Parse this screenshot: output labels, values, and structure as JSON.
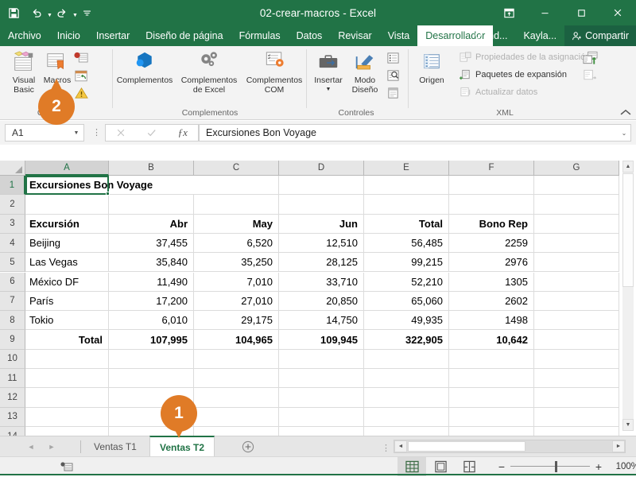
{
  "titlebar": {
    "document_title": "02-crear-macros  -  Excel",
    "quick_access": [
      {
        "name": "save-icon",
        "label": "Guardar"
      },
      {
        "name": "undo-icon",
        "label": "Deshacer"
      },
      {
        "name": "redo-icon",
        "label": "Rehacer"
      },
      {
        "name": "customize-qat-icon",
        "label": "Personalizar barra de herramientas de acceso rápido"
      }
    ],
    "window_buttons": [
      {
        "name": "ribbon-display-options-icon",
        "label": "Opciones de presentación de la cinta"
      },
      {
        "name": "minimize-icon",
        "label": "Minimizar",
        "glyph": "─"
      },
      {
        "name": "restore-icon",
        "label": "Restaurar",
        "glyph": "☐"
      },
      {
        "name": "close-icon",
        "label": "Cerrar",
        "glyph": "✕"
      }
    ]
  },
  "ribbon_tabs": {
    "items": [
      {
        "label": "Archivo",
        "active": false
      },
      {
        "label": "Inicio",
        "active": false
      },
      {
        "label": "Insertar",
        "active": false
      },
      {
        "label": "Diseño de página",
        "active": false
      },
      {
        "label": "Fórmulas",
        "active": false
      },
      {
        "label": "Datos",
        "active": false
      },
      {
        "label": "Revisar",
        "active": false
      },
      {
        "label": "Vista",
        "active": false
      },
      {
        "label": "Desarrollador",
        "active": true
      }
    ],
    "tell_me": "Ind...",
    "account_name": "Kayla...",
    "share_label": "Compartir"
  },
  "ribbon": {
    "groups": [
      {
        "name": "codigo",
        "label": "Có...",
        "buttons": [
          {
            "label_line1": "Visual",
            "label_line2": "Basic",
            "icon": "visual-basic-icon"
          },
          {
            "label_line1": "Macros",
            "label_line2": "",
            "icon": "macros-icon"
          }
        ],
        "small_icons": [
          {
            "name": "record-macro-icon"
          },
          {
            "name": "relative-references-icon"
          },
          {
            "name": "macro-security-icon"
          }
        ]
      },
      {
        "name": "complementos",
        "label": "Complementos",
        "buttons": [
          {
            "label_line1": "Complementos",
            "label_line2": "",
            "icon": "addins-store-icon"
          },
          {
            "label_line1": "Complementos",
            "label_line2": "de Excel",
            "icon": "excel-addins-icon"
          },
          {
            "label_line1": "Complementos",
            "label_line2": "COM",
            "icon": "com-addins-icon"
          }
        ]
      },
      {
        "name": "controles",
        "label": "Controles",
        "buttons": [
          {
            "label_line1": "Insertar",
            "label_line2": "",
            "icon": "insert-control-icon",
            "has_dropdown": true
          },
          {
            "label_line1": "Modo",
            "label_line2": "Diseño",
            "icon": "design-mode-icon"
          }
        ],
        "small_icons": [
          {
            "name": "properties-icon"
          },
          {
            "name": "view-code-icon"
          },
          {
            "name": "run-dialog-icon"
          }
        ]
      },
      {
        "name": "xml",
        "label": "XML",
        "buttons": [
          {
            "label_line1": "Origen",
            "label_line2": "",
            "icon": "xml-source-icon"
          }
        ],
        "commands": [
          {
            "label": "Propiedades de la asignación",
            "icon": "map-properties-icon",
            "disabled": true
          },
          {
            "label": "Paquetes de expansión",
            "icon": "expansion-packs-icon",
            "disabled": false
          },
          {
            "label": "Actualizar datos",
            "icon": "refresh-data-icon",
            "disabled": true
          }
        ],
        "small_icons": [
          {
            "name": "import-xml-icon"
          },
          {
            "name": "export-xml-icon"
          }
        ]
      }
    ],
    "collapse_label": "Contraer la cinta de opciones"
  },
  "formula_bar": {
    "name_box_value": "A1",
    "cancel_label": "Cancelar",
    "enter_label": "Introducir",
    "function_label": "Insertar función",
    "formula_value": "Excursiones Bon Voyage"
  },
  "grid": {
    "columns": [
      "A",
      "B",
      "C",
      "D",
      "E",
      "F",
      "G"
    ],
    "selected_column": "A",
    "rows": [
      1,
      2,
      3,
      4,
      5,
      6,
      7,
      8,
      9,
      10,
      11,
      12,
      13,
      14
    ],
    "selected_row": 1,
    "selected_cell": "A1",
    "cells": [
      {
        "row": 1,
        "col": "A",
        "value": "Excursiones Bon Voyage",
        "bold": true,
        "align": "left",
        "overflow": true
      },
      {
        "row": 3,
        "col": "A",
        "value": "Excursión",
        "bold": true,
        "align": "left"
      },
      {
        "row": 3,
        "col": "B",
        "value": "Abr",
        "bold": true,
        "align": "right"
      },
      {
        "row": 3,
        "col": "C",
        "value": "May",
        "bold": true,
        "align": "right"
      },
      {
        "row": 3,
        "col": "D",
        "value": "Jun",
        "bold": true,
        "align": "right"
      },
      {
        "row": 3,
        "col": "E",
        "value": "Total",
        "bold": true,
        "align": "right"
      },
      {
        "row": 3,
        "col": "F",
        "value": "Bono Rep",
        "bold": true,
        "align": "right"
      },
      {
        "row": 4,
        "col": "A",
        "value": "Beijing",
        "bold": false,
        "align": "left"
      },
      {
        "row": 4,
        "col": "B",
        "value": "37,455",
        "bold": false,
        "align": "right"
      },
      {
        "row": 4,
        "col": "C",
        "value": "6,520",
        "bold": false,
        "align": "right"
      },
      {
        "row": 4,
        "col": "D",
        "value": "12,510",
        "bold": false,
        "align": "right"
      },
      {
        "row": 4,
        "col": "E",
        "value": "56,485",
        "bold": false,
        "align": "right"
      },
      {
        "row": 4,
        "col": "F",
        "value": "2259",
        "bold": false,
        "align": "right"
      },
      {
        "row": 5,
        "col": "A",
        "value": "Las Vegas",
        "bold": false,
        "align": "left"
      },
      {
        "row": 5,
        "col": "B",
        "value": "35,840",
        "bold": false,
        "align": "right"
      },
      {
        "row": 5,
        "col": "C",
        "value": "35,250",
        "bold": false,
        "align": "right"
      },
      {
        "row": 5,
        "col": "D",
        "value": "28,125",
        "bold": false,
        "align": "right"
      },
      {
        "row": 5,
        "col": "E",
        "value": "99,215",
        "bold": false,
        "align": "right"
      },
      {
        "row": 5,
        "col": "F",
        "value": "2976",
        "bold": false,
        "align": "right"
      },
      {
        "row": 6,
        "col": "A",
        "value": "México DF",
        "bold": false,
        "align": "left"
      },
      {
        "row": 6,
        "col": "B",
        "value": "11,490",
        "bold": false,
        "align": "right"
      },
      {
        "row": 6,
        "col": "C",
        "value": "7,010",
        "bold": false,
        "align": "right"
      },
      {
        "row": 6,
        "col": "D",
        "value": "33,710",
        "bold": false,
        "align": "right"
      },
      {
        "row": 6,
        "col": "E",
        "value": "52,210",
        "bold": false,
        "align": "right"
      },
      {
        "row": 6,
        "col": "F",
        "value": "1305",
        "bold": false,
        "align": "right"
      },
      {
        "row": 7,
        "col": "A",
        "value": "París",
        "bold": false,
        "align": "left"
      },
      {
        "row": 7,
        "col": "B",
        "value": "17,200",
        "bold": false,
        "align": "right"
      },
      {
        "row": 7,
        "col": "C",
        "value": "27,010",
        "bold": false,
        "align": "right"
      },
      {
        "row": 7,
        "col": "D",
        "value": "20,850",
        "bold": false,
        "align": "right"
      },
      {
        "row": 7,
        "col": "E",
        "value": "65,060",
        "bold": false,
        "align": "right"
      },
      {
        "row": 7,
        "col": "F",
        "value": "2602",
        "bold": false,
        "align": "right"
      },
      {
        "row": 8,
        "col": "A",
        "value": "Tokio",
        "bold": false,
        "align": "left"
      },
      {
        "row": 8,
        "col": "B",
        "value": "6,010",
        "bold": false,
        "align": "right"
      },
      {
        "row": 8,
        "col": "C",
        "value": "29,175",
        "bold": false,
        "align": "right"
      },
      {
        "row": 8,
        "col": "D",
        "value": "14,750",
        "bold": false,
        "align": "right"
      },
      {
        "row": 8,
        "col": "E",
        "value": "49,935",
        "bold": false,
        "align": "right"
      },
      {
        "row": 8,
        "col": "F",
        "value": "1498",
        "bold": false,
        "align": "right"
      },
      {
        "row": 9,
        "col": "A",
        "value": "Total",
        "bold": true,
        "align": "right"
      },
      {
        "row": 9,
        "col": "B",
        "value": "107,995",
        "bold": true,
        "align": "right"
      },
      {
        "row": 9,
        "col": "C",
        "value": "104,965",
        "bold": true,
        "align": "right"
      },
      {
        "row": 9,
        "col": "D",
        "value": "109,945",
        "bold": true,
        "align": "right"
      },
      {
        "row": 9,
        "col": "E",
        "value": "322,905",
        "bold": true,
        "align": "right"
      },
      {
        "row": 9,
        "col": "F",
        "value": "10,642",
        "bold": true,
        "align": "right"
      }
    ]
  },
  "sheet_tabs": {
    "items": [
      {
        "label": "Ventas T1",
        "active": false
      },
      {
        "label": "Ventas T2",
        "active": true
      }
    ],
    "add_sheet_label": "+",
    "nav_first_label": "◄",
    "nav_last_label": "►"
  },
  "status_bar": {
    "ready_icon": "macro-record-icon",
    "view_buttons": [
      {
        "name": "normal-view-icon",
        "active": true
      },
      {
        "name": "page-layout-view-icon",
        "active": false
      },
      {
        "name": "page-break-view-icon",
        "active": false
      }
    ],
    "zoom_out_label": "−",
    "zoom_in_label": "+",
    "zoom_value": "100%"
  },
  "callouts": [
    {
      "number": "1",
      "target": "sheet-tab-ventas-t2"
    },
    {
      "number": "2",
      "target": "macros-button"
    }
  ],
  "colors": {
    "excel_green": "#217346",
    "callout_orange": "#e07b27",
    "ribbon_bg": "#f3f3f3",
    "header_bg": "#e6e6e6"
  }
}
